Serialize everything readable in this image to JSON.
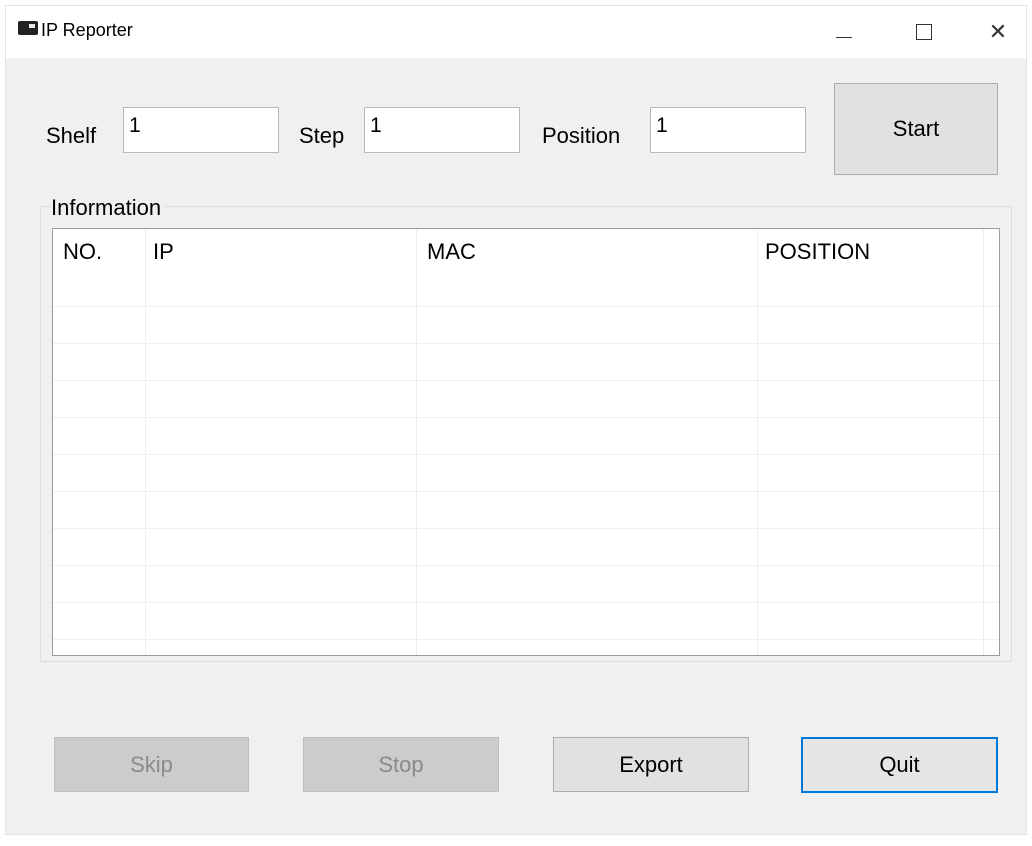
{
  "window": {
    "title": "IP Reporter",
    "controls": {
      "minimize": "—",
      "close": "✕"
    }
  },
  "form": {
    "shelf": {
      "label": "Shelf",
      "value": "1"
    },
    "step": {
      "label": "Step",
      "value": "1"
    },
    "position": {
      "label": "Position",
      "value": "1"
    },
    "start_label": "Start"
  },
  "information": {
    "group_label": "Information",
    "columns": [
      "NO.",
      "IP",
      "MAC",
      "POSITION"
    ],
    "rows": []
  },
  "buttons": {
    "skip": "Skip",
    "stop": "Stop",
    "export": "Export",
    "quit": "Quit"
  }
}
